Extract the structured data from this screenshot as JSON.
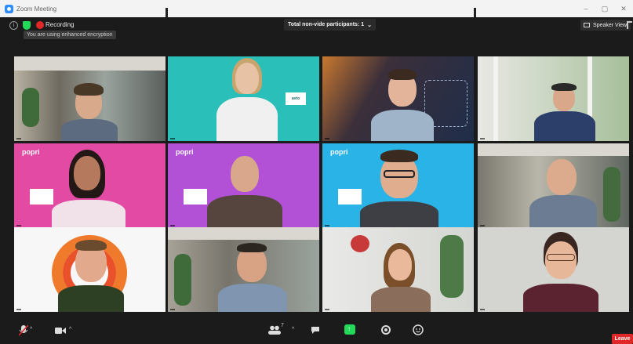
{
  "window": {
    "title": "Zoom Meeting"
  },
  "topbar": {
    "recording_label": "Recording",
    "encryption_tooltip": "You are using enhanced encryption",
    "view_pill": "Total non-vide  participants: 1",
    "speaker_view_label": "Speaker View"
  },
  "participants": [
    {
      "name": "",
      "bg": "#8a8f8c"
    },
    {
      "name": "",
      "bg": "#2bbfb9"
    },
    {
      "name": "",
      "bg": "#26334a"
    },
    {
      "name": "",
      "bg": "#c9c9c4"
    },
    {
      "name": "",
      "bg": "#e24aa4"
    },
    {
      "name": "",
      "bg": "#b251d6"
    },
    {
      "name": "",
      "bg": "#2ab3e6"
    },
    {
      "name": "",
      "bg": "#6a6a64"
    },
    {
      "name": "",
      "bg": "#f7f7f7"
    },
    {
      "name": "",
      "bg": "#7b7d78"
    },
    {
      "name": "",
      "bg": "#e8e8e8"
    },
    {
      "name": "",
      "bg": "#d4d4d0"
    }
  ],
  "toolbar": {
    "participants_count": "7",
    "leave_label": "Leave"
  },
  "colors": {
    "accent_blue": "#2d8cff",
    "record_red": "#e02828",
    "share_green": "#23d959"
  }
}
